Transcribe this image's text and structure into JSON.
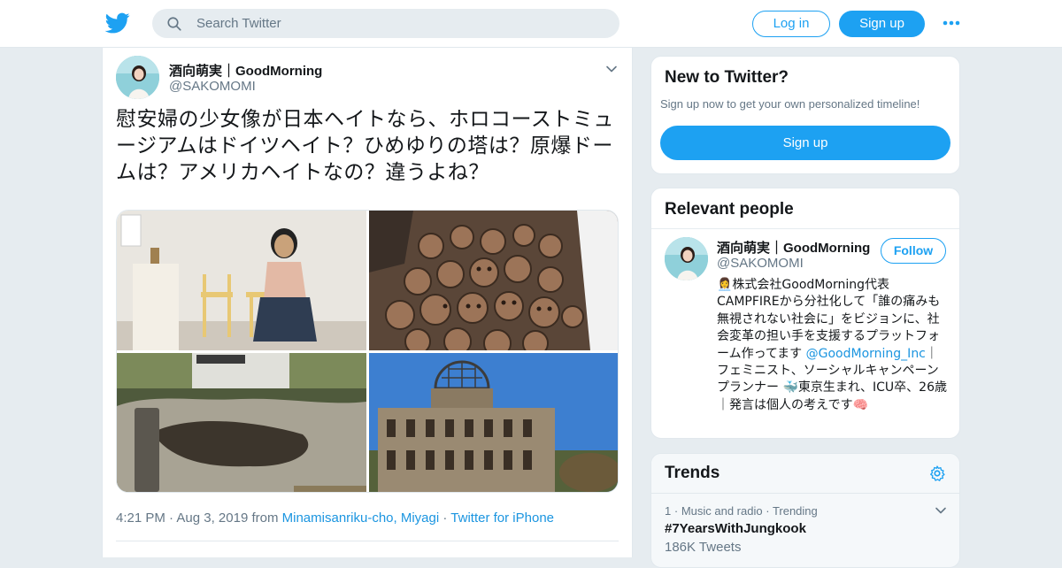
{
  "header": {
    "logo_icon": "twitter-bird-icon",
    "search_placeholder": "Search Twitter",
    "login_label": "Log in",
    "signup_label": "Sign up",
    "more_icon": "more-dots-icon",
    "accent": "#1da1f2"
  },
  "tweet": {
    "author_name": "酒向萌実｜GoodMorning",
    "author_handle": "@SAKOMOMI",
    "text": "慰安婦の少女像が日本ヘイトなら、ホロコーストミュージアムはドイツヘイト？ひめゆりの塔は？原爆ドームは？アメリカヘイトなの？違うよね？",
    "media_count": 4,
    "time": "4:21 PM",
    "date": "Aug 3, 2019",
    "from_label": "from",
    "location": "Minamisanriku-cho, Miyagi",
    "source": "Twitter for iPhone"
  },
  "new_to_twitter": {
    "title": "New to Twitter?",
    "subtitle": "Sign up now to get your own personalized timeline!",
    "button": "Sign up"
  },
  "relevant_people": {
    "title": "Relevant people",
    "name": "酒向萌実｜GoodMorning",
    "handle": "@SAKOMOMI",
    "follow_label": "Follow",
    "bio_part1": "👩‍💼株式会社GoodMorning代表 CAMPFIREから分社化して「誰の痛みも無視されない社会に」をビジョンに、社会変革の担い手を支援するプラットフォーム作ってます",
    "bio_link": "@GoodMorning_Inc",
    "bio_part2": "｜フェミニスト、ソーシャルキャンペーンプランナー 🐳東京生まれ、ICU卒、26歳｜発言は個人の考えです🧠"
  },
  "trends": {
    "title": "Trends",
    "items": [
      {
        "rank": "1",
        "category": "Music and radio",
        "status": "Trending",
        "name": "#7YearsWithJungkook",
        "count": "186K Tweets"
      }
    ]
  }
}
